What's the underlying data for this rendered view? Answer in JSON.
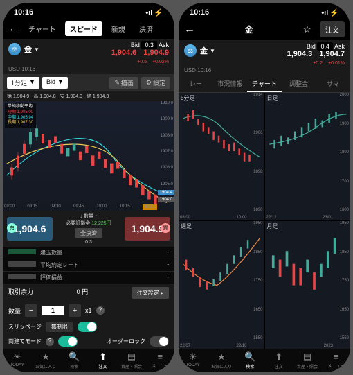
{
  "status": {
    "time": "10:16",
    "signal": "•ıl",
    "wifi": "⚡"
  },
  "left": {
    "tabs": [
      "チャート",
      "スピード",
      "新規",
      "決済"
    ],
    "active_tab": 1,
    "instrument": {
      "icon": "⚖",
      "name": "金",
      "usd": "USD",
      "time": "10:16"
    },
    "bidask": {
      "bid_lbl": "Bid",
      "spread": "0.3",
      "ask_lbl": "Ask",
      "bid": "1,904.6",
      "ask": "1,904.9",
      "bid_chg": "+0.5",
      "ask_chg": "+0.02%"
    },
    "timeframe": "1分足",
    "type": "Bid",
    "draw": "描画",
    "settings": "設定",
    "ohlc": {
      "o": "始 1,904.9",
      "h": "高 1,904.8",
      "l": "安 1,904.0",
      "c": "終 1,904.3"
    },
    "ma": {
      "title": "単純移動平均",
      "s": "短期 1,905.00",
      "m": "中期 1,905.94",
      "l": "長期 1,907.30"
    },
    "y": [
      "1910.0",
      "1909.0",
      "1908.0",
      "1907.0",
      "1906.0",
      "1905.0",
      "1904.0"
    ],
    "x": [
      "09:00",
      "09:15",
      "09:30",
      "09:45",
      "10:00",
      "10:15"
    ],
    "price_tag": "1904.4",
    "time_tag": "10:16",
    "cur_price": "1904.0",
    "trade": {
      "sell_ico": "売",
      "buy_ico": "買",
      "sell": "1,904.6",
      "buy": "1,904.9",
      "qty_lbl": "数量",
      "margin_lbl": "必要証拠金",
      "margin": "12,225円",
      "close_all": "全決済",
      "spread": "0.3"
    },
    "pos": [
      "建玉数量",
      "平均約定レート",
      "評価損益"
    ],
    "summary": {
      "lbl": "取引余力",
      "val": "0 円",
      "btn": "注文設定 ▸"
    },
    "qty": {
      "lbl": "数量",
      "val": "1",
      "mult": "x1",
      "help": "?"
    },
    "slip": {
      "lbl": "スリッページ",
      "val": "無制限"
    },
    "dual": {
      "lbl": "両建てモード",
      "help": "?",
      "lock": "オーダーロック"
    }
  },
  "right": {
    "title": "金",
    "order": "注文",
    "bidask": {
      "bid_lbl": "Bid",
      "spread": "0.4",
      "ask_lbl": "Ask",
      "bid": "1,904.3",
      "ask": "1,904.7",
      "bid_chg": "+0.2",
      "ask_chg": "+0.01%"
    },
    "instrument": {
      "icon": "⚖",
      "name": "金",
      "usd": "USD",
      "time": "10:16"
    },
    "subtabs": [
      "レー",
      "市況情報",
      "チャート",
      "調整金",
      "サマ"
    ],
    "active_sub": 2,
    "charts": [
      {
        "title": "5分足",
        "y": [
          "1914",
          "1906",
          "1898",
          "1890"
        ],
        "x": [
          "08:00",
          "10:00"
        ]
      },
      {
        "title": "日足",
        "y": [
          "2000",
          "1900",
          "1800",
          "1700",
          "1600"
        ],
        "x": [
          "22/12",
          "23/01"
        ]
      },
      {
        "title": "週足",
        "y": [
          "1950",
          "1850",
          "1750",
          "1650",
          "1550"
        ],
        "x": [
          "22/07",
          "22/10"
        ]
      },
      {
        "title": "月足",
        "y": [
          "1950",
          "1850",
          "1750",
          "1650",
          "1550"
        ],
        "x": [
          "2023"
        ]
      }
    ]
  },
  "tabbar": [
    {
      "ico": "☀",
      "lbl": "TODAY"
    },
    {
      "ico": "★",
      "lbl": "お気に入り"
    },
    {
      "ico": "🔍",
      "lbl": "検索"
    },
    {
      "ico": "⬆",
      "lbl": "注文"
    },
    {
      "ico": "▤",
      "lbl": "資産・照会"
    },
    {
      "ico": "≡",
      "lbl": "メニュー"
    }
  ],
  "chart_data": {
    "type": "candlestick",
    "note": "Gold (金) price chart, 1-minute timeframe, approximate OHLC read from pixels",
    "ylim": [
      1904,
      1910
    ],
    "series": [
      {
        "t": "09:00",
        "o": 1906.5,
        "h": 1907.2,
        "l": 1906.0,
        "c": 1906.8
      },
      {
        "t": "09:05",
        "o": 1906.8,
        "h": 1908.5,
        "l": 1906.5,
        "c": 1908.2
      },
      {
        "t": "09:10",
        "o": 1908.2,
        "h": 1909.5,
        "l": 1908.0,
        "c": 1909.0
      },
      {
        "t": "09:15",
        "o": 1909.0,
        "h": 1909.8,
        "l": 1908.5,
        "c": 1908.8
      },
      {
        "t": "09:20",
        "o": 1908.8,
        "h": 1909.0,
        "l": 1907.5,
        "c": 1907.8
      },
      {
        "t": "09:25",
        "o": 1907.8,
        "h": 1908.5,
        "l": 1907.0,
        "c": 1908.0
      },
      {
        "t": "09:30",
        "o": 1908.0,
        "h": 1908.2,
        "l": 1906.5,
        "c": 1906.8
      },
      {
        "t": "09:35",
        "o": 1906.8,
        "h": 1907.5,
        "l": 1906.0,
        "c": 1907.2
      },
      {
        "t": "09:40",
        "o": 1907.2,
        "h": 1908.0,
        "l": 1907.0,
        "c": 1907.5
      },
      {
        "t": "09:45",
        "o": 1907.5,
        "h": 1907.8,
        "l": 1906.0,
        "c": 1906.3
      },
      {
        "t": "09:50",
        "o": 1906.3,
        "h": 1907.5,
        "l": 1906.0,
        "c": 1907.0
      },
      {
        "t": "09:55",
        "o": 1907.0,
        "h": 1907.2,
        "l": 1905.5,
        "c": 1905.8
      },
      {
        "t": "10:00",
        "o": 1905.8,
        "h": 1906.5,
        "l": 1905.0,
        "c": 1905.5
      },
      {
        "t": "10:05",
        "o": 1905.5,
        "h": 1906.0,
        "l": 1904.5,
        "c": 1905.0
      },
      {
        "t": "10:10",
        "o": 1905.0,
        "h": 1905.2,
        "l": 1904.0,
        "c": 1904.3
      },
      {
        "t": "10:15",
        "o": 1904.9,
        "h": 1904.8,
        "l": 1904.0,
        "c": 1904.3
      }
    ],
    "ma": {
      "short": 1905.0,
      "mid": 1905.94,
      "long": 1907.3
    }
  }
}
